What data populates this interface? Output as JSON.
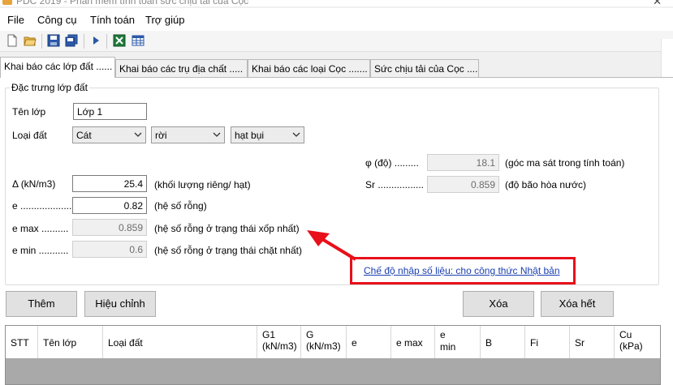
{
  "window": {
    "title": "PDC 2019 - Phần mềm tính toán sức chịu tải của Cọc"
  },
  "menu": [
    "File",
    "Công cụ",
    "Tính toán",
    "Trợ giúp"
  ],
  "tabs": [
    "Khai báo các lớp đất ......",
    "Khai báo các trụ địa chất .....",
    "Khai báo các loại Cọc .......",
    "Sức chịu tải của Cọc ......"
  ],
  "group": {
    "title": "Đặc trưng lớp đất",
    "ten_lop_label": "Tên lớp",
    "ten_lop_value": "Lớp 1",
    "loai_dat_label": "Loại đất",
    "combo1": "Cát",
    "combo2": "rời",
    "combo3": "hạt bụi",
    "phi_label": "φ (độ) .........",
    "phi_value": "18.1",
    "phi_desc": "(góc ma sát trong tính toán)",
    "sr_label": "Sr .................",
    "sr_value": "0.859",
    "sr_desc": "(độ bão hòa nước)",
    "delta_label": "Δ  (kN/m3)",
    "delta_value": "25.4",
    "delta_desc": "(khối lượng riêng/ hạt)",
    "e_label": "e .....................",
    "e_value": "0.82",
    "e_desc": "(hệ số rỗng)",
    "emax_label": "e max ..........",
    "emax_value": "0.859",
    "emax_desc": "(hệ số rỗng ở trạng thái xốp nhất)",
    "emin_label": "e min ...........",
    "emin_value": "0.6",
    "emin_desc": "(hệ số rỗng ở trạng thái chặt nhất)",
    "link": "Chế độ nhập số liệu: cho công thức Nhật bản"
  },
  "buttons": {
    "them": "Thêm",
    "hieu_chinh": "Hiệu chỉnh",
    "xoa": "Xóa",
    "xoa_het": "Xóa hết"
  },
  "grid": {
    "columns": [
      {
        "l1": "STT"
      },
      {
        "l1": "Tên lớp"
      },
      {
        "l1": "Loại đất"
      },
      {
        "l1": "G1",
        "l2": "(kN/m3)"
      },
      {
        "l1": "G",
        "l2": "(kN/m3)"
      },
      {
        "l1": "e"
      },
      {
        "l1": "e max"
      },
      {
        "l1": "e",
        "l2": "min"
      },
      {
        "l1": "B"
      },
      {
        "l1": "Fi"
      },
      {
        "l1": "Sr"
      },
      {
        "l1": "Cu",
        "l2": "(kPa)"
      }
    ]
  },
  "colors": {
    "annotation": "#e8101a",
    "link": "#1a3fb0"
  },
  "icons": [
    "new-file-icon",
    "open-folder-icon",
    "save-icon",
    "save-all-icon",
    "run-icon",
    "excel-icon",
    "table-icon"
  ]
}
